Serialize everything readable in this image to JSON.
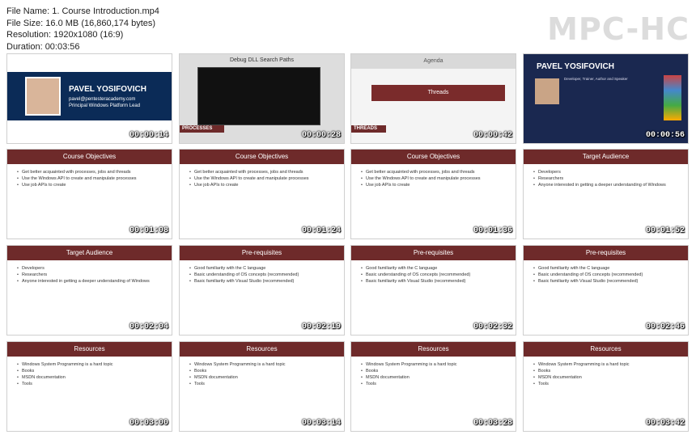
{
  "header": {
    "file_name": "File Name: 1. Course Introduction.mp4",
    "file_size": "File Size: 16.0 MB (16,860,174 bytes)",
    "resolution": "Resolution: 1920x1080 (16:9)",
    "duration": "Duration: 00:03:56"
  },
  "logo": "MPC-HC",
  "thumbnails": [
    {
      "kind": "intro",
      "name": "PAVEL YOSIFOVICH",
      "email": "pavel@pentesteracademy.com",
      "role": "Principal Windows Platform Lead",
      "time": "00:00:14"
    },
    {
      "kind": "processes",
      "title": "Debug DLL Search Paths",
      "label": "PROCESSES",
      "time": "00:00:28"
    },
    {
      "kind": "threads",
      "title": "Agenda",
      "highlight": "Threads",
      "label": "THREADS",
      "time": "00:00:42"
    },
    {
      "kind": "pavel",
      "name": "PAVEL YOSIFOVICH",
      "role": "Developer, Trainer, Author and Speaker",
      "time": "00:00:56"
    },
    {
      "kind": "slide",
      "title": "Course Objectives",
      "lines": [
        "Get better acquainted with processes, jobs and threads",
        "Use the Windows API to create and manipulate processes",
        "Use job APIs to create"
      ],
      "time": "00:01:08"
    },
    {
      "kind": "slide",
      "title": "Course Objectives",
      "lines": [
        "Get better acquainted with processes, jobs and threads",
        "Use the Windows API to create and manipulate processes",
        "Use job APIs to create"
      ],
      "time": "00:01:24"
    },
    {
      "kind": "slide",
      "title": "Course Objectives",
      "lines": [
        "Get better acquainted with processes, jobs and threads",
        "Use the Windows API to create and manipulate processes",
        "Use job APIs to create"
      ],
      "time": "00:01:36"
    },
    {
      "kind": "slide",
      "title": "Target Audience",
      "lines": [
        "Developers",
        "Researchers",
        "Anyone interested in getting a deeper understanding of Windows"
      ],
      "time": "00:01:52"
    },
    {
      "kind": "slide",
      "title": "Target Audience",
      "lines": [
        "Developers",
        "Researchers",
        "Anyone interested in getting a deeper understanding of Windows"
      ],
      "time": "00:02:04"
    },
    {
      "kind": "slide",
      "title": "Pre-requisites",
      "lines": [
        "Good familiarity with the C language",
        "Basic understanding of OS concepts (recommended)",
        "Basic familiarity with Visual Studio (recommended)"
      ],
      "time": "00:02:19"
    },
    {
      "kind": "slide",
      "title": "Pre-requisites",
      "lines": [
        "Good familiarity with the C language",
        "Basic understanding of OS concepts (recommended)",
        "Basic familiarity with Visual Studio (recommended)"
      ],
      "time": "00:02:32"
    },
    {
      "kind": "slide",
      "title": "Pre-requisites",
      "lines": [
        "Good familiarity with the C language",
        "Basic understanding of OS concepts (recommended)",
        "Basic familiarity with Visual Studio (recommended)"
      ],
      "time": "00:02:46"
    },
    {
      "kind": "slide",
      "title": "Resources",
      "lines": [
        "Windows System Programming is a hard topic",
        "Books",
        "MSDN documentation",
        "Tools"
      ],
      "time": "00:03:00"
    },
    {
      "kind": "slide",
      "title": "Resources",
      "lines": [
        "Windows System Programming is a hard topic",
        "Books",
        "MSDN documentation",
        "Tools"
      ],
      "time": "00:03:14"
    },
    {
      "kind": "slide",
      "title": "Resources",
      "lines": [
        "Windows System Programming is a hard topic",
        "Books",
        "MSDN documentation",
        "Tools"
      ],
      "time": "00:03:28"
    },
    {
      "kind": "slide",
      "title": "Resources",
      "lines": [
        "Windows System Programming is a hard topic",
        "Books",
        "MSDN documentation",
        "Tools"
      ],
      "time": "00:03:42"
    }
  ]
}
